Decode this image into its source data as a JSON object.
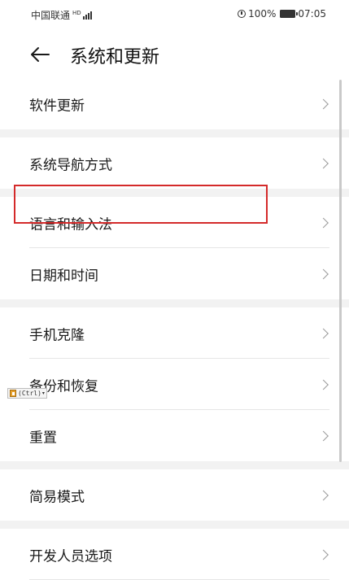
{
  "status_bar": {
    "carrier": "中国联通",
    "signal_label": "HD",
    "battery": "100%",
    "time": "07:05"
  },
  "header": {
    "title": "系统和更新"
  },
  "items": [
    {
      "label": "软件更新"
    },
    {
      "label": "系统导航方式"
    },
    {
      "label": "语言和输入法"
    },
    {
      "label": "日期和时间"
    },
    {
      "label": "手机克隆"
    },
    {
      "label": "备份和恢复"
    },
    {
      "label": "重置"
    },
    {
      "label": "简易模式"
    },
    {
      "label": "开发人员选项"
    }
  ],
  "paste_badge": {
    "label": "(Ctrl)"
  },
  "colors": {
    "highlight": "#d42a2a",
    "chevron": "#9a9a9a",
    "section_gap": "#f2f2f2"
  }
}
